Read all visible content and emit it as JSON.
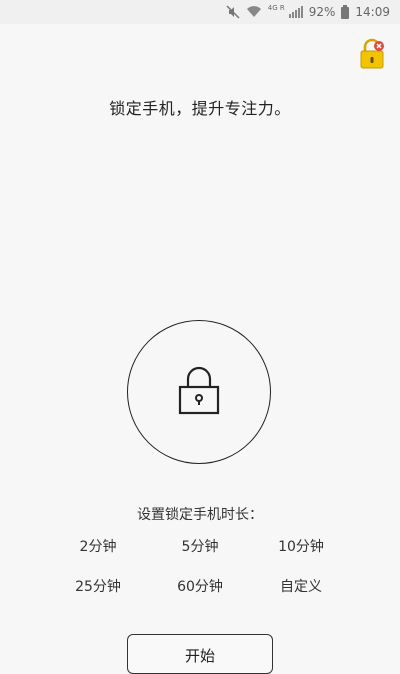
{
  "status_bar": {
    "network": "4G R",
    "battery": "92%",
    "time": "14:09"
  },
  "headline": "锁定手机，提升专注力。",
  "duration_label": "设置锁定手机时长：",
  "options": [
    "2分钟",
    "5分钟",
    "10分钟",
    "25分钟",
    "60分钟",
    "自定义"
  ],
  "start_label": "开始",
  "colors": {
    "background": "#f7f7f7",
    "badge_lock": "#f2c300",
    "badge_x": "#e24a3b"
  }
}
